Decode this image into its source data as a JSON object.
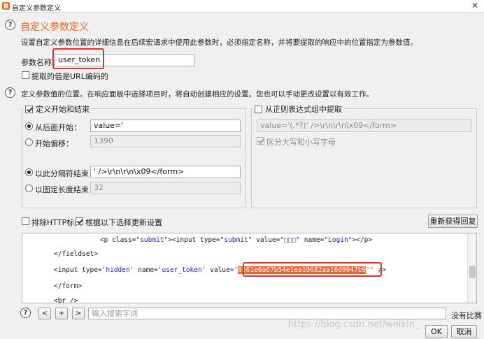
{
  "window": {
    "title": "自定义参数定义",
    "close_glyph": "✕"
  },
  "help_glyph": "?",
  "section": {
    "title": "自定义参数定义",
    "description": "设置自定义参数位置的详细信息在后续宏请求中使用此参数时，必须指定名称，并将要提取的响应中的位置指定为参数值。"
  },
  "param": {
    "name_label": "参数名称：",
    "name_value": "user_token",
    "url_encoded_label": "提取的值是URL编码的",
    "url_encoded_checked": false
  },
  "location_desc": "定义参数值的位置。在响应面板中选择项目时，将自动创建相应的设置。您也可以手动更改设置以有效工作。",
  "define_start_end": {
    "legend": "定义开始和结束",
    "checked": true,
    "start_after_label": "从后面开始：",
    "start_after_value": "value='",
    "start_after_selected": true,
    "start_offset_label": "开始偏移：",
    "start_offset_value": "1390",
    "end_delim_label": "以此分隔符结束：",
    "end_delim_value": "' />\\r\\n\\r\\n\\x09</form>",
    "end_delim_selected": true,
    "fixed_length_label": "以固定长度结束：",
    "fixed_length_value": "32"
  },
  "regex_group": {
    "legend": "从正则表达式组中提取",
    "checked": false,
    "regex_value": "value='(.*?)' />\\r\\n\\r\\n\\x09</form>",
    "case_sensitive_label": "区分大写和小写字母",
    "case_sensitive_checked": true
  },
  "options": {
    "exclude_headers_label": "排除HTTP标头",
    "exclude_headers_checked": false,
    "update_on_select_label": "根据以下选择更新设置",
    "update_on_select_checked": true,
    "refetch_label": "重新获得回复"
  },
  "response": {
    "line1_indent": "                  ",
    "line1": [
      {
        "t": "<p ",
        "c": "tag"
      },
      {
        "t": "class",
        "c": "attr"
      },
      {
        "t": "=",
        "c": "tag"
      },
      {
        "t": "\"submit\"",
        "c": "str"
      },
      {
        "t": "><input ",
        "c": "tag"
      },
      {
        "t": "type",
        "c": "attr"
      },
      {
        "t": "=",
        "c": "tag"
      },
      {
        "t": "\"submit\"",
        "c": "str"
      },
      {
        "t": " value",
        "c": "attr"
      },
      {
        "t": "=",
        "c": "tag"
      },
      {
        "t": "\"□□□\"",
        "c": "str"
      },
      {
        "t": " name",
        "c": "attr"
      },
      {
        "t": "=",
        "c": "tag"
      },
      {
        "t": "\"Login\"",
        "c": "str"
      },
      {
        "t": "></p>",
        "c": "tag"
      }
    ],
    "line2": "</fieldset>",
    "line3_a": "<input ",
    "line3_b": "type",
    "line3_c": "=",
    "line3_d": "'hidden'",
    "line3_e": " name",
    "line3_f": "=",
    "line3_g": "'user_token'",
    "line3_h": " value",
    "line3_i": "='",
    "line3_token": "8561e6a67b54e1ea19682aa16d9947b9",
    "line3_tail": "' />",
    "line4": "</form>",
    "line5": "<br />"
  },
  "search": {
    "prev_label": "<",
    "add_label": "+",
    "next_label": ">",
    "placeholder": "输入搜索字词",
    "match_status": "没有比赛"
  },
  "footer": {
    "ok_label": "OK",
    "cancel_label": "取消",
    "watermark": "https://blog.csdn.net/weixin_"
  },
  "colors": {
    "accent_orange": "#e8672d",
    "highlight_box": "#e0302a"
  }
}
